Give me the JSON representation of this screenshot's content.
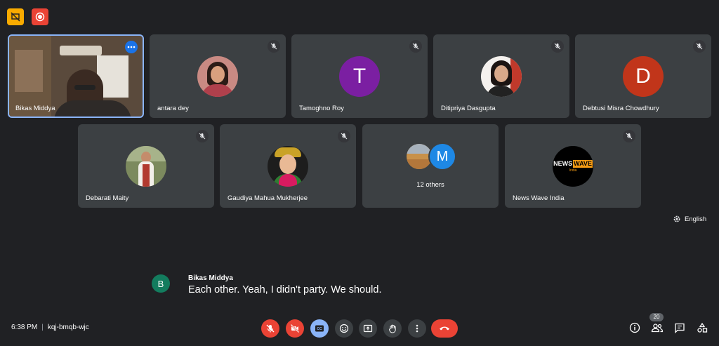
{
  "participants": [
    {
      "name": "Bikas Middya"
    },
    {
      "name": "antara dey"
    },
    {
      "name": "Tamoghno Roy",
      "initial": "T",
      "color": "#7b1fa2"
    },
    {
      "name": "Ditipriya Dasgupta"
    },
    {
      "name": "Debtusi Misra Chowdhury",
      "initial": "D",
      "color": "#c1351a"
    },
    {
      "name": "Debarati Maity"
    },
    {
      "name": "Gaudiya Mahua Mukherjee"
    },
    {
      "name": "News Wave India",
      "logo_text_1": "NEWS",
      "logo_text_2": "WAVE",
      "logo_text_3": "India"
    }
  ],
  "others": {
    "label": "12 others",
    "initial": "M",
    "color": "#1e88e5"
  },
  "captions": {
    "language": "English",
    "speaker": "Bikas Middya",
    "speaker_initial": "B",
    "speaker_color": "#137c5e",
    "text": "Each other. Yeah, I didn't party. We should."
  },
  "bottom": {
    "time": "6:38 PM",
    "separator": "|",
    "meeting_code": "kqj-bmqb-wjc",
    "people_count": "20"
  },
  "colors": {
    "background": "#202124",
    "tile": "#3c4043",
    "danger": "#ea4335",
    "active_tile_border": "#8ab4f8",
    "warning": "#f9ab00"
  }
}
